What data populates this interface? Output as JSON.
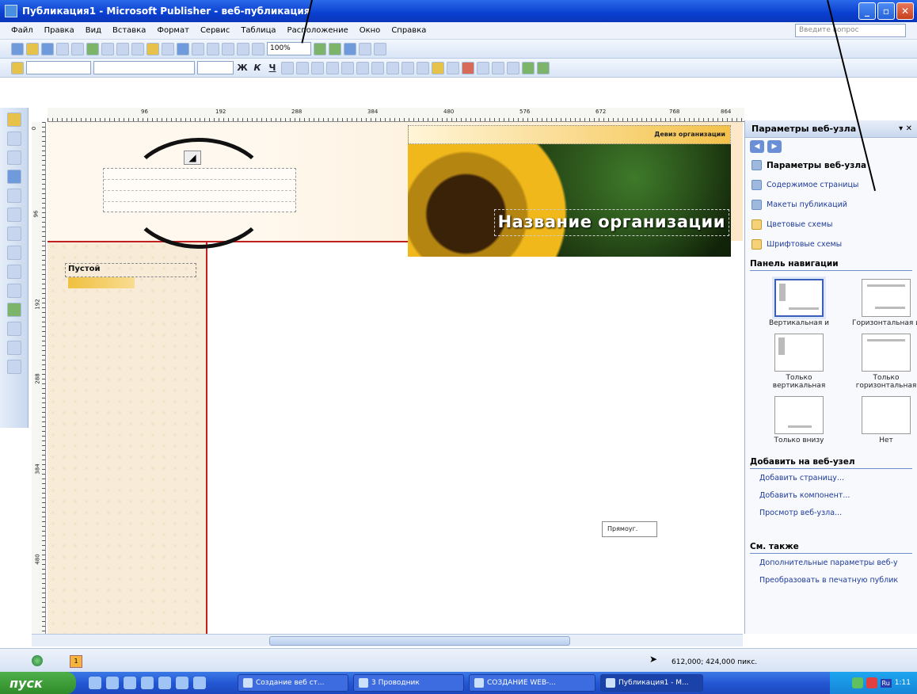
{
  "window": {
    "title": "Публикация1 - Microsoft Publisher - веб-публикация",
    "buttons": [
      "_",
      "▫",
      "✕"
    ]
  },
  "menu": {
    "items": [
      "Файл",
      "Правка",
      "Вид",
      "Вставка",
      "Формат",
      "Сервис",
      "Таблица",
      "Расположение",
      "Окно",
      "Справка"
    ],
    "ask_placeholder": "Введите вопрос"
  },
  "toolbar": {
    "zoom": "100%",
    "format_buttons": [
      "Ж",
      "К",
      "Ч"
    ]
  },
  "ruler": {
    "h_ticks": [
      "96",
      "192",
      "288",
      "384",
      "480",
      "576",
      "672",
      "768",
      "864"
    ],
    "v_ticks": [
      "0",
      "96",
      "192",
      "288",
      "384",
      "480"
    ]
  },
  "page": {
    "motto": "Девиз организации",
    "org_name": "Название организации",
    "nav_label": "Пустой",
    "tooltip": "Прямоуг."
  },
  "taskpane": {
    "title": "Параметры веб-узла",
    "links": [
      {
        "label": "Параметры веб-узла",
        "icon": "web-options-icon"
      },
      {
        "label": "Содержимое страницы",
        "icon": "page-content-icon"
      },
      {
        "label": "Макеты публикаций",
        "icon": "publication-designs-icon"
      },
      {
        "label": "Цветовые схемы",
        "icon": "color-schemes-icon"
      },
      {
        "label": "Шрифтовые схемы",
        "icon": "font-schemes-icon"
      }
    ],
    "nav_section": "Панель навигации",
    "nav_options": [
      {
        "label": "Вертикальная и",
        "selected": true
      },
      {
        "label": "Горизонтальная и",
        "selected": false
      },
      {
        "label": "Только вертикальная",
        "selected": false
      },
      {
        "label": "Только горизонтальная",
        "selected": false
      },
      {
        "label": "Только внизу",
        "selected": false
      },
      {
        "label": "Нет",
        "selected": false
      }
    ],
    "add_section": "Добавить на веб-узел",
    "add_links": [
      "Добавить страницу...",
      "Добавить компонент...",
      "Просмотр веб-узла..."
    ],
    "see_also_section": "См. также",
    "see_also_links": [
      "Дополнительные параметры веб-у",
      "Преобразовать в печатную публик"
    ]
  },
  "status": {
    "page_number": "1",
    "coordinates": "612,000; 424,000 пикс."
  },
  "taskbar": {
    "start": "пуск",
    "tasks": [
      "Создание веб ст...",
      "3 Проводник",
      "СОЗДАНИЕ WEB-...",
      "Публикация1 - М..."
    ],
    "lang": "Ru",
    "clock": "1:11"
  },
  "colors": {
    "title_bar": "#0a3fd0",
    "accent_red": "#c02020",
    "nav_yellow": "#f0c040",
    "taskbar": "#2457d3",
    "start_green": "#3a9a34"
  }
}
